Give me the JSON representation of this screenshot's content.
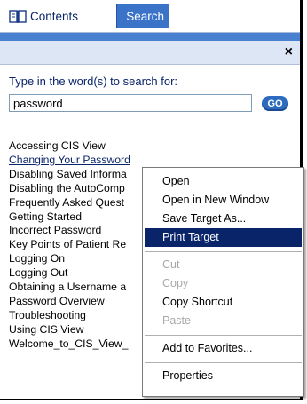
{
  "tabs": {
    "contents_label": "Contents",
    "search_label": "Search"
  },
  "search": {
    "prompt": "Type in the word(s) to search for:",
    "query": "password",
    "go_label": "GO"
  },
  "close_label": "×",
  "results": [
    "Accessing CIS View",
    "Changing Your Password",
    "Disabling Saved Informa",
    "Disabling the AutoComp",
    "Frequently Asked Quest",
    "Getting Started",
    "Incorrect Password",
    "Key Points of Patient Re",
    "Logging On",
    "Logging Out",
    "Obtaining a Username a",
    "Password Overview",
    "Troubleshooting",
    "Using CIS View",
    "Welcome_to_CIS_View_"
  ],
  "context_menu": {
    "open": "Open",
    "open_new_window": "Open in New Window",
    "save_target": "Save Target As...",
    "print_target": "Print Target",
    "cut": "Cut",
    "copy": "Copy",
    "copy_shortcut": "Copy Shortcut",
    "paste": "Paste",
    "add_favorites": "Add to Favorites...",
    "properties": "Properties"
  },
  "colors": {
    "accent": "#3a73c8",
    "menu_highlight": "#0a246a",
    "link": "#0a246a"
  }
}
